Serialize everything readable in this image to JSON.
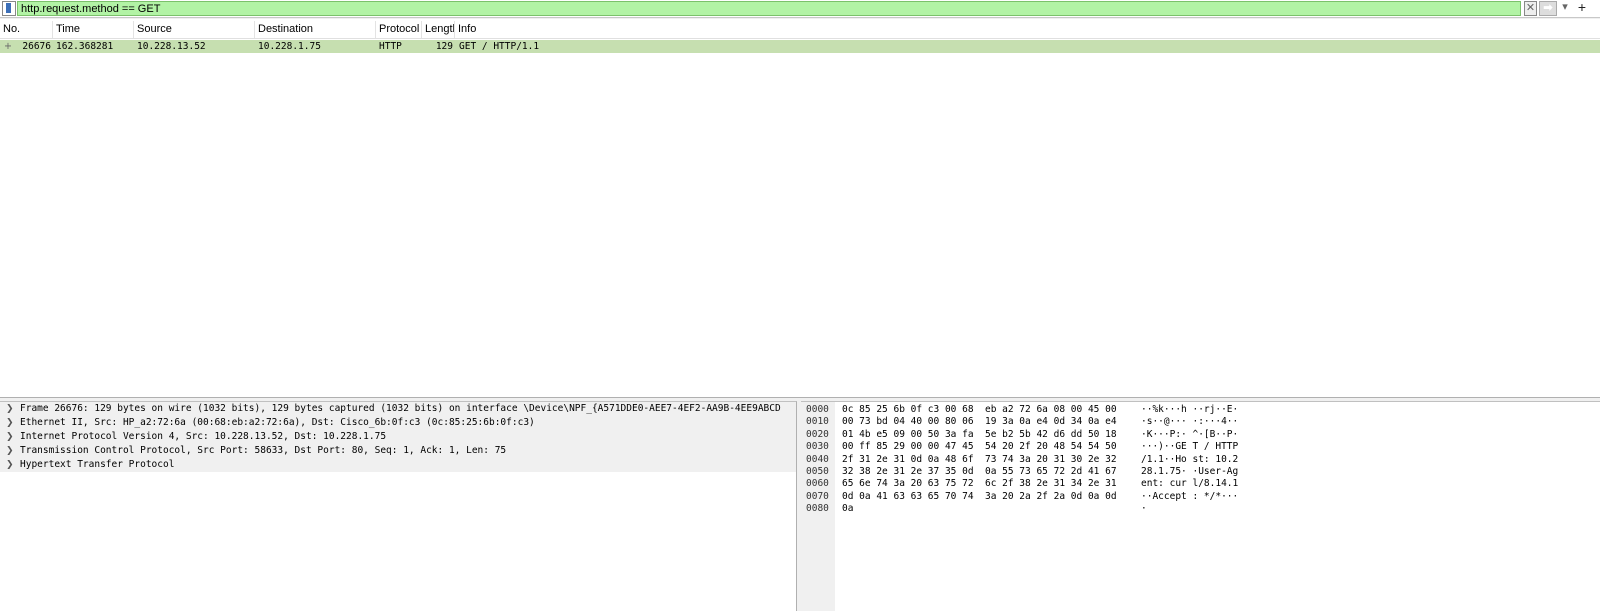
{
  "filter": {
    "value": "http.request.method == GET",
    "add_label": "+",
    "dropdown_label": "▾"
  },
  "columns": [
    "No.",
    "Time",
    "Source",
    "Destination",
    "Protocol",
    "Length",
    "Info"
  ],
  "packets": [
    {
      "no": "26676",
      "time": "162.368281",
      "source": "10.228.13.52",
      "destination": "10.228.1.75",
      "protocol": "HTTP",
      "length": "129",
      "info": "GET / HTTP/1.1"
    }
  ],
  "details": [
    "Frame 26676: 129 bytes on wire (1032 bits), 129 bytes captured (1032 bits) on interface \\Device\\NPF_{A571DDE0-AEE7-4EF2-AA9B-4EE9ABCD",
    "Ethernet II, Src: HP_a2:72:6a (00:68:eb:a2:72:6a), Dst: Cisco_6b:0f:c3 (0c:85:25:6b:0f:c3)",
    "Internet Protocol Version 4, Src: 10.228.13.52, Dst: 10.228.1.75",
    "Transmission Control Protocol, Src Port: 58633, Dst Port: 80, Seq: 1, Ack: 1, Len: 75",
    "Hypertext Transfer Protocol"
  ],
  "bytes": [
    {
      "offset": "0000",
      "hex": "0c 85 25 6b 0f c3 00 68  eb a2 72 6a 08 00 45 00",
      "ascii": "··%k···h ··rj··E·"
    },
    {
      "offset": "0010",
      "hex": "00 73 bd 04 40 00 80 06  19 3a 0a e4 0d 34 0a e4",
      "ascii": "·s··@··· ·:···4··"
    },
    {
      "offset": "0020",
      "hex": "01 4b e5 09 00 50 3a fa  5e b2 5b 42 d6 dd 50 18",
      "ascii": "·K···P:· ^·[B··P·"
    },
    {
      "offset": "0030",
      "hex": "00 ff 85 29 00 00 47 45  54 20 2f 20 48 54 54 50",
      "ascii": "···)··GE T / HTTP"
    },
    {
      "offset": "0040",
      "hex": "2f 31 2e 31 0d 0a 48 6f  73 74 3a 20 31 30 2e 32",
      "ascii": "/1.1··Ho st: 10.2"
    },
    {
      "offset": "0050",
      "hex": "32 38 2e 31 2e 37 35 0d  0a 55 73 65 72 2d 41 67",
      "ascii": "28.1.75· ·User-Ag"
    },
    {
      "offset": "0060",
      "hex": "65 6e 74 3a 20 63 75 72  6c 2f 38 2e 31 34 2e 31",
      "ascii": "ent: cur l/8.14.1"
    },
    {
      "offset": "0070",
      "hex": "0d 0a 41 63 63 65 70 74  3a 20 2a 2f 2a 0d 0a 0d",
      "ascii": "··Accept : */*···"
    },
    {
      "offset": "0080",
      "hex": "0a",
      "ascii": "·"
    }
  ],
  "colors": {
    "filter_valid": "#b2f3a5",
    "row_http": "#c6dfb0",
    "pane_bg": "#f0f0f0"
  },
  "icons": {
    "bookmark": "bookmark-icon",
    "clear": "clear-filter-icon",
    "apply": "apply-filter-icon",
    "tree_arrow": "chevron-right-icon"
  }
}
